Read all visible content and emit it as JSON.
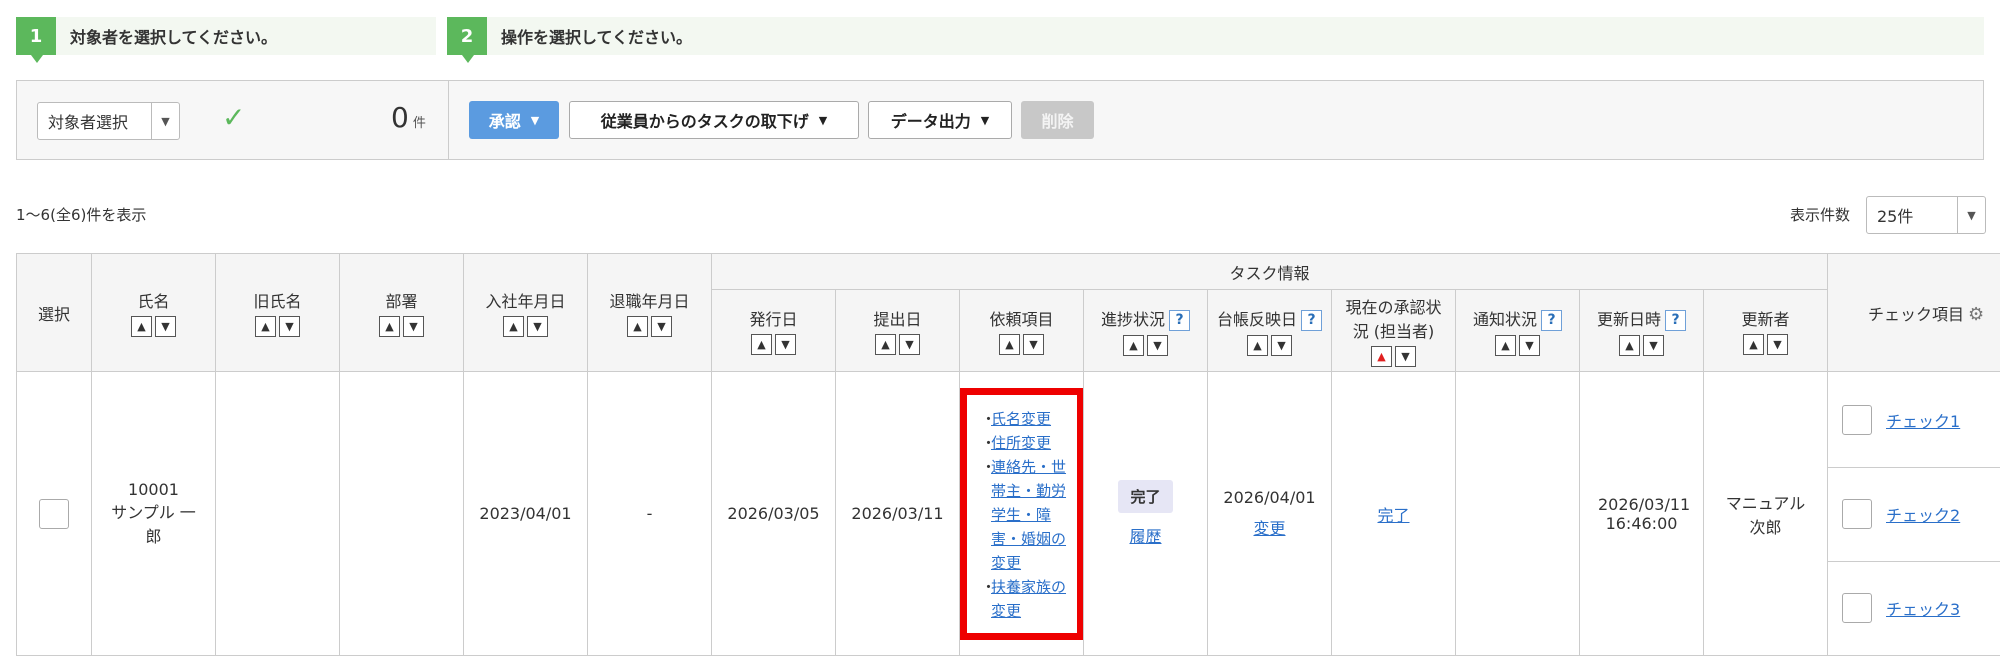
{
  "steps": [
    {
      "num": "1",
      "text": "対象者を選択してください。"
    },
    {
      "num": "2",
      "text": "操作を選択してください。"
    }
  ],
  "toolbar": {
    "target_select": "対象者選択",
    "count_value": "0",
    "count_unit": "件",
    "approve": "承認",
    "retract": "従業員からのタスクの取下げ",
    "export": "データ出力",
    "delete": "削除"
  },
  "list_info": {
    "range": "1〜6(全6)件を表示",
    "per_page_label": "表示件数",
    "per_page_value": "25件"
  },
  "headers": {
    "select": "選択",
    "name": "氏名",
    "old_name": "旧氏名",
    "dept": "部署",
    "join": "入社年月日",
    "leave": "退職年月日",
    "task_group": "タスク情報",
    "issued": "発行日",
    "submitted": "提出日",
    "request": "依頼項目",
    "progress": "進捗状況",
    "ledger": "台帳反映日",
    "approval": "現在の承認状況 (担当者)",
    "notice": "通知状況",
    "updated": "更新日時",
    "updater": "更新者",
    "check": "チェック項目"
  },
  "row": {
    "emp_no": "10001",
    "name": "サンプル 一郎",
    "old_name": "",
    "dept": "",
    "join": "2023/04/01",
    "leave": "-",
    "issued": "2026/03/05",
    "submitted": "2026/03/11",
    "requests": [
      "氏名変更",
      "住所変更",
      "連絡先・世帯主・勤労学生・障害・婚姻の変更",
      "扶養家族の変更"
    ],
    "progress": "完了",
    "history": "履歴",
    "ledger_date": "2026/04/01",
    "ledger_change": "変更",
    "approval": "完了",
    "notice": "",
    "updated": "2026/03/11 16:46:00",
    "updater": "マニュアル 次郎",
    "checks": [
      "チェック1",
      "チェック2",
      "チェック3"
    ]
  },
  "colors": {
    "step_green": "#5cb85c",
    "primary_blue": "#5b9be0",
    "highlight_red": "#ee0000",
    "link_blue": "#2a6fc9"
  },
  "icons": {
    "check": "checkmark-icon",
    "caret": "chevron-down-icon",
    "sort_up": "sort-asc-icon",
    "sort_down": "sort-desc-icon",
    "help": "help-icon",
    "gear": "gear-icon"
  }
}
